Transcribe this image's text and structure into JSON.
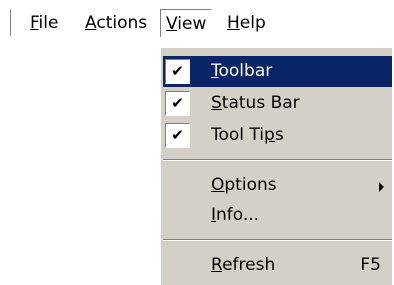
{
  "menubar": {
    "items": [
      {
        "accel": "F",
        "rest": "ile"
      },
      {
        "accel": "A",
        "rest": "ctions"
      },
      {
        "accel": "V",
        "rest": "iew"
      },
      {
        "accel": "H",
        "rest": "elp"
      }
    ]
  },
  "view_menu": {
    "toolbar": {
      "accel": "T",
      "rest": "oolbar",
      "check": "✔"
    },
    "status_bar": {
      "accel": "S",
      "rest": "tatus Bar",
      "check": "✔"
    },
    "tool_tips": {
      "pre": "Tool Ti",
      "accel": "p",
      "rest": "s",
      "check": "✔"
    },
    "options": {
      "accel": "O",
      "rest": "ptions"
    },
    "info": {
      "accel": "I",
      "rest": "nfo..."
    },
    "refresh": {
      "accel": "R",
      "rest": "efresh",
      "shortcut": "F5"
    }
  },
  "colors": {
    "menu_background": "#d4d0c8",
    "highlight": "#0a246a",
    "highlight_text": "#ffffff"
  }
}
